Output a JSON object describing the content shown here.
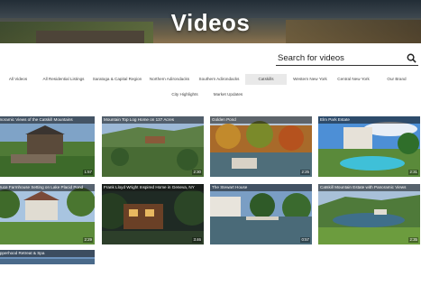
{
  "hero": {
    "title": "Videos"
  },
  "search": {
    "placeholder": "Search for videos"
  },
  "filters": [
    {
      "label": "All Videos"
    },
    {
      "label": "All Residential Listings"
    },
    {
      "label": "Saratoga & Capital Region"
    },
    {
      "label": "Northern Adirondacks"
    },
    {
      "label": "Southern Adirondacks"
    },
    {
      "label": "Catskills"
    },
    {
      "label": "Western New York"
    },
    {
      "label": "Central New York"
    },
    {
      "label": "Our Brand"
    },
    {
      "label": "City Highlights"
    },
    {
      "label": "Market Updates"
    }
  ],
  "videos": [
    {
      "title": "Panoramic Views of the Catskill Mountains",
      "duration": "1:57"
    },
    {
      "title": "Mountain Top Log Home on 137 Acres",
      "duration": "2:30"
    },
    {
      "title": "Golden Pond",
      "duration": "2:25"
    },
    {
      "title": "Elm Park Estate",
      "duration": "2:31"
    },
    {
      "title": "Spruce Farmhouse Setting on Lake Placid Pond",
      "duration": "2:29"
    },
    {
      "title": "Frank Lloyd Wright Inspired Home in Geneva, NY",
      "duration": "3:46"
    },
    {
      "title": "The Stewart House",
      "duration": "0:57"
    },
    {
      "title": "Catskill Mountain Estate with Panoramic Views",
      "duration": "2:35"
    },
    {
      "title": "Copperhood Retreat & Spa",
      "duration": ""
    }
  ]
}
